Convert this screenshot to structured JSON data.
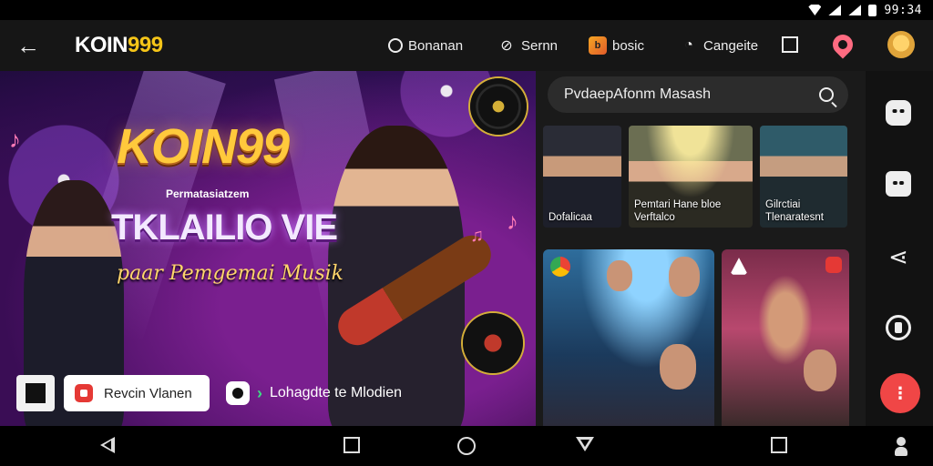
{
  "status": {
    "time": "99:34"
  },
  "header": {
    "back_icon": "arrow-left-icon",
    "logo_prefix": "KOIN",
    "logo_suffix": "999",
    "nav": [
      {
        "icon": "circle-icon",
        "label": "Bonanan"
      },
      {
        "icon": "leaf-icon",
        "label": "Sernn"
      },
      {
        "icon": "bookmark-icon",
        "label": "bosic"
      },
      {
        "icon": "chat-icon",
        "label": "Cangeite"
      }
    ],
    "square_icon": "square-icon",
    "pin_icon": "location-pin-icon",
    "avatar_icon": "avatar-icon"
  },
  "hero": {
    "title": "KOIN99",
    "subtitle": "Permatasiatzem",
    "headline": "TKLAILIO VIE",
    "tagline": "paar Pemgemai Musik",
    "watch_button": "Revcin Vlanen",
    "download_label": "Lohagdte te Mlodien"
  },
  "search": {
    "placeholder": "PvdaepAfonm Masash"
  },
  "thumbnails": [
    {
      "caption_line1": "Dofalicaa",
      "caption_line2": ""
    },
    {
      "caption_line1": "Pemtari Hane bloe",
      "caption_line2": "Verftalco"
    },
    {
      "caption_line1": "Gilrctiai",
      "caption_line2": "Tlenaratesnt"
    }
  ],
  "colors": {
    "accent": "#f5c518",
    "fab": "#f04646",
    "rail_bg": "#121212"
  },
  "rail": {
    "icons": [
      "robot-icon",
      "bag-icon",
      "share-icon",
      "phone-icon"
    ],
    "fab_label": "⋮"
  }
}
